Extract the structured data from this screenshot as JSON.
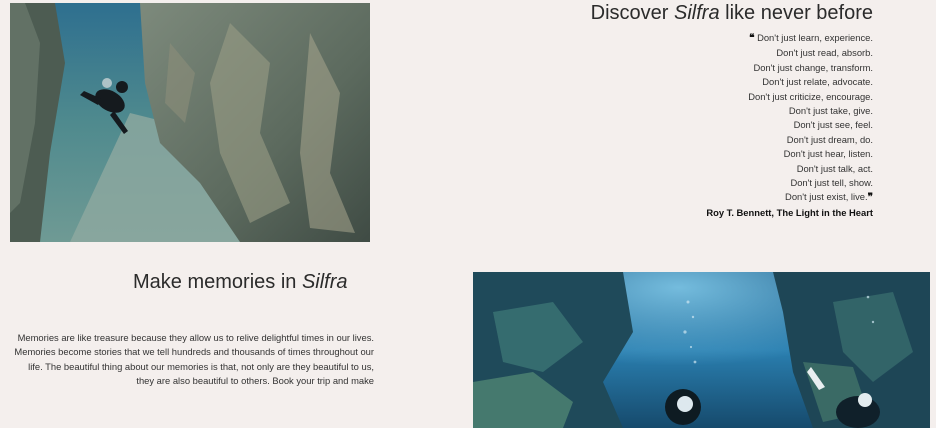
{
  "discover": {
    "title_prefix": "Discover ",
    "title_emph": "Silfra",
    "title_suffix": " like never before",
    "quote_lines": [
      "Don't just learn, experience.",
      "Don't just read, absorb.",
      "Don't just change, transform.",
      "Don't just relate, advocate.",
      "Don't just criticize, encourage.",
      "Don't just take, give.",
      "Don't just see, feel.",
      "Don't just dream, do.",
      "Don't just hear, listen.",
      "Don't just talk, act.",
      "Don't just tell, show.",
      "Don't just exist, live."
    ],
    "open_quote": "❝",
    "close_quote": "❞",
    "attribution": "Roy T. Bennett, The Light in the Heart"
  },
  "memories": {
    "title_prefix": "Make memories in ",
    "title_emph": "Silfra",
    "body": "Memories are like treasure because they allow us to relive delightful times in our lives. Memories become stories that we tell hundreds and thousands of times throughout our life. The beautiful thing about our memories is that, not only are they beautiful to us, they are also beautiful to others. Book your trip and make"
  }
}
